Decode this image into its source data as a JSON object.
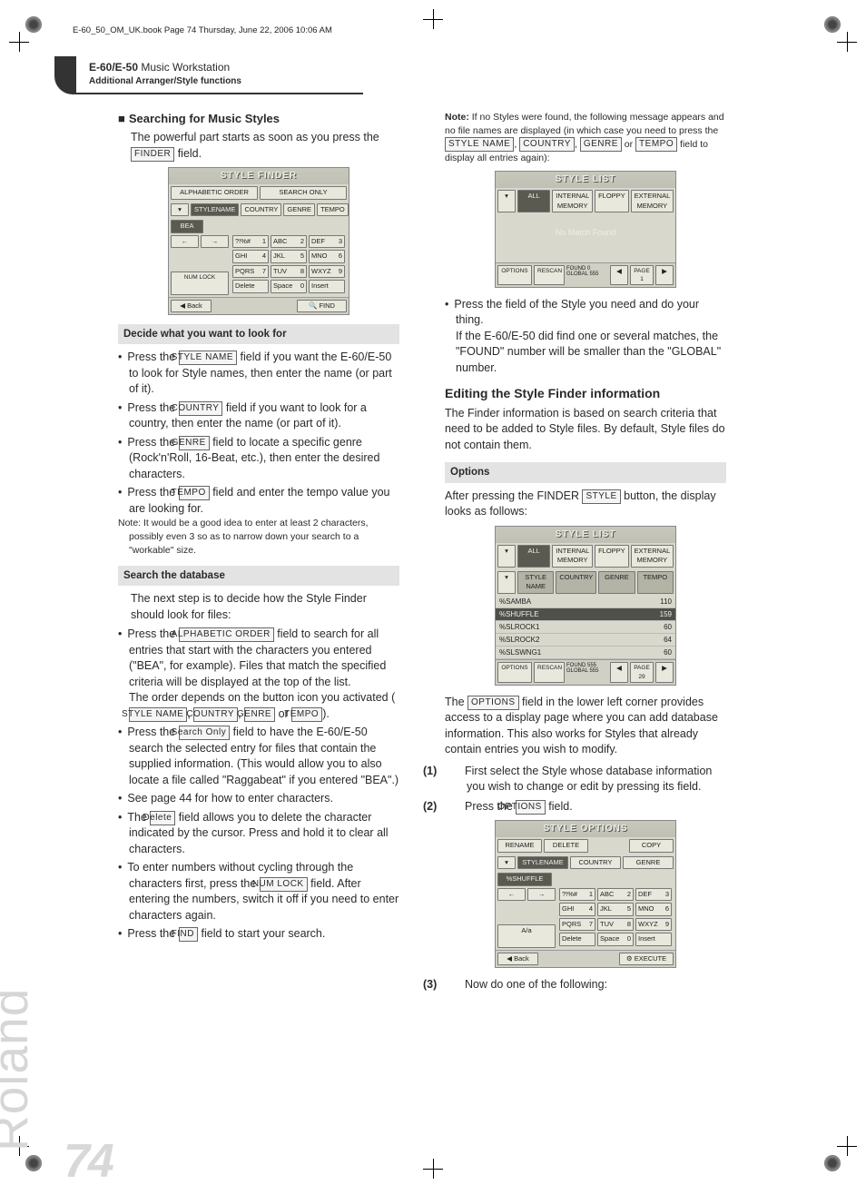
{
  "headerline": "E-60_50_OM_UK.book  Page 74  Thursday, June 22, 2006  10:06 AM",
  "pagehead": {
    "product": "E-60/E-50",
    "tag": "Music Workstation",
    "sub": "Additional Arranger/Style functions"
  },
  "side_brand": "Roland",
  "pagenum": "74",
  "left": {
    "h3": "Searching for Music Styles",
    "p1a": "The powerful part starts as soon as you press the ",
    "p1btn": "FINDER",
    "p1b": " field.",
    "shot1": {
      "title": "STYLE FINDER",
      "top": [
        "ALPHABETIC ORDER",
        "SEARCH ONLY"
      ],
      "tabs": [
        "STYLENAME",
        "COUNTRY",
        "GENRE",
        "TEMPO"
      ],
      "bea": "BEA",
      "keys": [
        "?!%#",
        "1",
        "ABC",
        "2",
        "DEF",
        "3",
        "GHI",
        "4",
        "JKL",
        "5",
        "MNO",
        "6",
        "PQRS",
        "7",
        "TUV",
        "8",
        "WXYZ",
        "9"
      ],
      "edit": [
        "NUM LOCK",
        "Delete",
        "Space",
        "0",
        "Insert"
      ],
      "arrows": [
        "←",
        "→"
      ],
      "back": "Back",
      "find": "FIND"
    },
    "sub1": "Decide what you want to look for",
    "b1a": "Press the ",
    "b1btn": "STYLE NAME",
    "b1b": " field if you want the E-60/E-50 to look for Style names, then enter the name (or part of it).",
    "b2a": "Press the ",
    "b2btn": "COUNTRY",
    "b2b": " field if you want to look for a country, then enter the name (or part of it).",
    "b3a": "Press the ",
    "b3btn": "GENRE",
    "b3b": " field to locate a specific genre (Rock'n'Roll, 16-Beat, etc.), then enter the desired characters.",
    "b4a": "Press the ",
    "b4btn": "TEMPO",
    "b4b": " field and enter the tempo value you are looking for.",
    "note1": "Note: It would be a good idea to enter at least 2 characters, possibly even 3 so as to narrow down your search to a \"workable\" size.",
    "sub2": "Search the database",
    "p2": "The next step is to decide how the Style Finder should look for files:",
    "c1a": "Press the ",
    "c1btn": "ALPHABETIC ORDER",
    "c1b": " field to search for all entries that start with the characters you entered (\"BEA\", for example). Files that match the specified criteria will be displayed at the top of the list.",
    "c1c": "The order depends on the button icon you activated (",
    "c1btns": [
      "STYLE NAME",
      "COUNTRY",
      "GENRE",
      "TEMPO"
    ],
    "c1d": ").",
    "c2a": "Press the ",
    "c2btn": "Search Only",
    "c2b": " field to have the E-60/E-50 search the selected entry for files that contain the supplied information. (This would allow you to also locate a file called \"Raggabeat\" if you entered \"BEA\".)",
    "c3": "See page 44 for how to enter characters.",
    "c4a": "The ",
    "c4btn": "Delete",
    "c4b": " field allows you to delete the character indicated by the cursor. Press and hold it to clear all characters.",
    "c5a": "To enter numbers without cycling through the characters first, press the ",
    "c5btn": "NUM LOCK",
    "c5b": " field. After entering the numbers, switch it off if you need to enter characters again.",
    "c6a": "Press the ",
    "c6btn": "FIND",
    "c6b": " field to start your search."
  },
  "right": {
    "note2a": "Note:",
    "note2b": " If no Styles were found, the following message appears and no file names are displayed (in which case you need to press the ",
    "note2btns": [
      "STYLE NAME",
      "COUNTRY",
      "GENRE",
      "TEMPO"
    ],
    "note2c": " field to display all entries again):",
    "shot2": {
      "title": "STYLE LIST",
      "top": [
        "ALL",
        "INTERNAL MEMORY",
        "FLOPPY",
        "EXTERNAL MEMORY"
      ],
      "msg": "No Match Found",
      "opt": "OPTIONS",
      "resc": "RESCAN",
      "found": "FOUND  0",
      "global": "GLOBAL 555",
      "page": "PAGE 1"
    },
    "r1": "Press the field of the Style you need and do your thing.",
    "r1b": "If the E-60/E-50 did find one or several matches, the \"FOUND\" number will be smaller than the \"GLOBAL\" number.",
    "h2": "Editing the Style Finder information",
    "r2": "The Finder information is based on search criteria that need to be added to Style files. By default, Style files do not contain them.",
    "sub3": "Options",
    "r3a": "After pressing the FINDER ",
    "r3btn": "STYLE",
    "r3b": " button, the display looks as follows:",
    "shot3": {
      "title": "STYLE LIST",
      "top": [
        "ALL",
        "INTERNAL MEMORY",
        "FLOPPY",
        "EXTERNAL MEMORY"
      ],
      "cols": [
        "STYLE NAME",
        "COUNTRY",
        "GENRE",
        "TEMPO"
      ],
      "rows": [
        [
          "%SAMBA",
          "110"
        ],
        [
          "%SHUFFLE",
          "159"
        ],
        [
          "%SLROCK1",
          "60"
        ],
        [
          "%SLROCK2",
          "64"
        ],
        [
          "%SLSWNG1",
          "60"
        ]
      ],
      "opt": "OPTIONS",
      "resc": "RESCAN",
      "found": "FOUND 555",
      "global": "GLOBAL 555",
      "page": "PAGE 29"
    },
    "r4a": "The ",
    "r4btn": "OPTIONS",
    "r4b": " field in the lower left corner provides access to a display page where you can add database information. This also works for Styles that already contain entries you wish to modify.",
    "s1": "First select the Style whose database information you wish to change or edit by pressing its field.",
    "s2a": "Press the ",
    "s2btn": "OPTIONS",
    "s2b": " field.",
    "shot4": {
      "title": "STYLE OPTIONS",
      "top": [
        "RENAME",
        "DELETE",
        "COPY"
      ],
      "tabs": [
        "STYLENAME",
        "COUNTRY",
        "GENRE"
      ],
      "val": "%SHUFFLE",
      "keys": [
        "?!%#",
        "1",
        "ABC",
        "2",
        "DEF",
        "3",
        "GHI",
        "4",
        "JKL",
        "5",
        "MNO",
        "6",
        "PQRS",
        "7",
        "TUV",
        "8",
        "WXYZ",
        "9"
      ],
      "edit": [
        "A/a",
        "Delete",
        "Space",
        "0",
        "Insert"
      ],
      "arrows": [
        "←",
        "→"
      ],
      "back": "Back",
      "exec": "EXECUTE"
    },
    "s3": "Now do one of the following:"
  }
}
